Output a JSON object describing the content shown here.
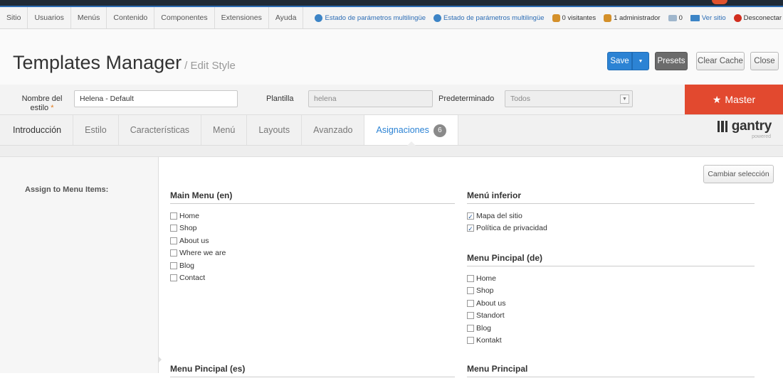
{
  "menubar": {
    "items": [
      "Sitio",
      "Usuarios",
      "Menús",
      "Contenido",
      "Componentes",
      "Extensiones",
      "Ayuda"
    ],
    "status": [
      {
        "icon": "globe-icon",
        "label": "Estado de parámetros multilingüe"
      },
      {
        "icon": "globe-icon",
        "label": "Estado de parámetros multilingüe"
      },
      {
        "icon": "users-icon",
        "label": "0 visitantes"
      },
      {
        "icon": "users-icon",
        "label": "1 administrador"
      },
      {
        "icon": "mail-icon",
        "label": "0"
      },
      {
        "icon": "screen-icon",
        "label": "Ver sitio"
      },
      {
        "icon": "power-icon",
        "label": "Desconectar"
      }
    ]
  },
  "header": {
    "title": "Templates Manager",
    "subtitle": "/ Edit Style",
    "buttons": {
      "save": "Save",
      "presets": "Presets",
      "clear_cache": "Clear Cache",
      "close": "Close"
    }
  },
  "fields": {
    "style_name_label": "Nombre del estilo",
    "style_name_value": "Helena - Default",
    "template_label": "Plantilla",
    "template_value": "helena",
    "default_label": "Predeterminado",
    "default_value": "Todos",
    "master_label": "Master"
  },
  "tabs": [
    {
      "label": "Introducción"
    },
    {
      "label": "Estilo"
    },
    {
      "label": "Características"
    },
    {
      "label": "Menú"
    },
    {
      "label": "Layouts"
    },
    {
      "label": "Avanzado"
    },
    {
      "label": "Asignaciones",
      "badge": "6",
      "active": true
    }
  ],
  "gantry": {
    "word": "gantry",
    "powered": "powered"
  },
  "assign": {
    "label": "Assign to Menu Items:",
    "change_button": "Cambiar selección",
    "groups": [
      {
        "title": "Main Menu (en)",
        "items": [
          {
            "label": "Home",
            "checked": false
          },
          {
            "label": "Shop",
            "checked": false
          },
          {
            "label": "About us",
            "checked": false
          },
          {
            "label": "Where we are",
            "checked": false
          },
          {
            "label": "Blog",
            "checked": false
          },
          {
            "label": "Contact",
            "checked": false
          }
        ]
      },
      {
        "title": "Menú inferior",
        "items": [
          {
            "label": "Mapa del sitio",
            "checked": true
          },
          {
            "label": "Política de privacidad",
            "checked": true
          }
        ]
      },
      {
        "title": "Menu Pincipal (de)",
        "items": [
          {
            "label": "Home",
            "checked": false
          },
          {
            "label": "Shop",
            "checked": false
          },
          {
            "label": "About us",
            "checked": false
          },
          {
            "label": "Standort",
            "checked": false
          },
          {
            "label": "Blog",
            "checked": false
          },
          {
            "label": "Kontakt",
            "checked": false
          }
        ]
      },
      {
        "title": "Menu Pincipal (es)",
        "items": []
      },
      {
        "title": "Menu Principal",
        "items": []
      }
    ]
  }
}
